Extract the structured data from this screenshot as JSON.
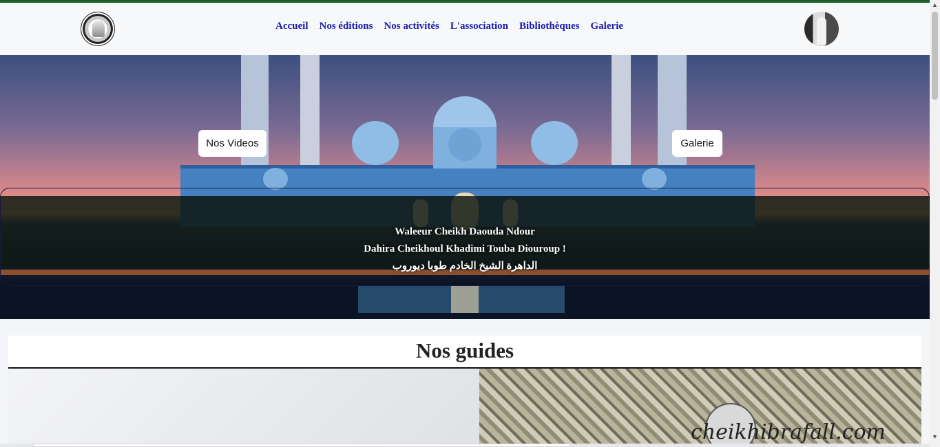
{
  "nav": {
    "links": [
      "Accueil",
      "Nos éditions",
      "Nos activités",
      "L'association",
      "Bibliothèques",
      "Galerie"
    ]
  },
  "hero": {
    "button_left": "Nos Videos",
    "button_right": "Galerie",
    "caption_line1": "Waleeur Cheikh Daouda Ndour",
    "caption_line2": "Dahira Cheikhoul Khadimi Touba Diouroup !",
    "caption_line3": "الداهرة الشيخ الخادم طوبا ديوروب"
  },
  "guides": {
    "title": "Nos guides",
    "watermark": "cheikhibrafall.com"
  },
  "colors": {
    "top_bar": "#1f5e2a",
    "nav_link": "#1b1bb0",
    "navbar_bg": "#f7f8fa"
  }
}
